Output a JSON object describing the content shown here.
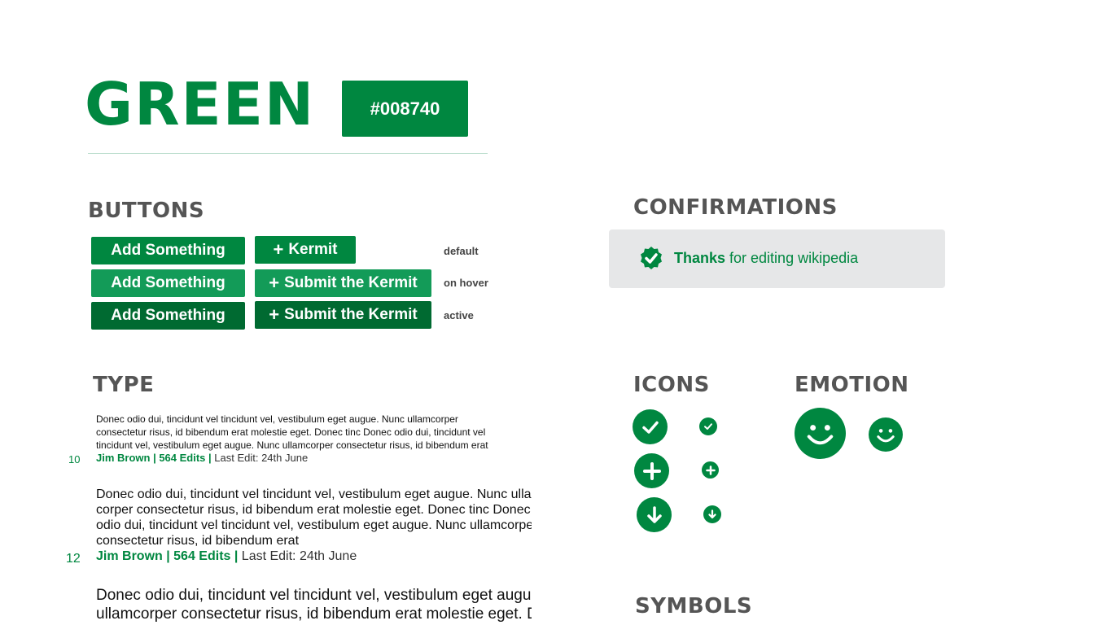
{
  "header": {
    "title": "GREEN",
    "hex": "#008740"
  },
  "buttons_section": {
    "heading": "BUTTONS",
    "rows": [
      {
        "primary": "Add Something",
        "secondary": "Kermit",
        "state": "default"
      },
      {
        "primary": "Add Something",
        "secondary": "Submit the Kermit",
        "state": "on hover"
      },
      {
        "primary": "Add Something",
        "secondary": "Submit the Kermit",
        "state": "active"
      }
    ],
    "plus_glyph": "+"
  },
  "confirmations": {
    "heading": "CONFIRMATIONS",
    "message_bold": "Thanks",
    "message_rest": " for editing wikipedia",
    "icon": "badge-check-icon"
  },
  "type_section": {
    "heading": "TYPE",
    "samples": [
      {
        "size": "10",
        "lines": [
          "Donec odio dui, tincidunt vel tincidunt vel, vestibulum eget augue. Nunc ullamcorper",
          "consectetur risus, id bibendum erat molestie eget. Donec tinc Donec odio dui, tincidunt vel",
          "tincidunt vel, vestibulum eget augue. Nunc ullamcorper consectetur risus, id bibendum erat"
        ],
        "author": "Jim Brown | 564 Edits |",
        "edit": " Last Edit: 24th June"
      },
      {
        "size": "12",
        "lines": [
          "Donec odio dui, tincidunt vel tincidunt vel, vestibulum eget augue. Nunc ulla",
          "corper consectetur risus, id bibendum erat molestie eget. Donec tinc Donec",
          "odio dui, tincidunt vel tincidunt vel, vestibulum eget augue. Nunc ullamcorpe",
          "consectetur risus, id bibendum erat"
        ],
        "author": "Jim Brown | 564 Edits |",
        "edit": " Last Edit: 24th June"
      },
      {
        "size": "",
        "lines": [
          "Donec odio dui, tincidunt vel tincidunt vel, vestibulum eget augue",
          "ullamcorper consectetur risus, id bibendum erat molestie eget. D"
        ]
      }
    ]
  },
  "icons_section": {
    "heading": "ICONS",
    "icons": [
      "check-icon",
      "check-icon-small",
      "plus-icon",
      "plus-icon-small",
      "arrow-down-icon",
      "arrow-down-icon-small"
    ]
  },
  "emotion_section": {
    "heading": "EMOTION",
    "icons": [
      "smiley-icon",
      "smiley-icon-small"
    ]
  },
  "symbols_section": {
    "heading": "SYMBOLS"
  },
  "colors": {
    "brand": "#008740",
    "hover": "#139b58",
    "active": "#006a31",
    "confirm_bg": "#e6e7e8"
  }
}
